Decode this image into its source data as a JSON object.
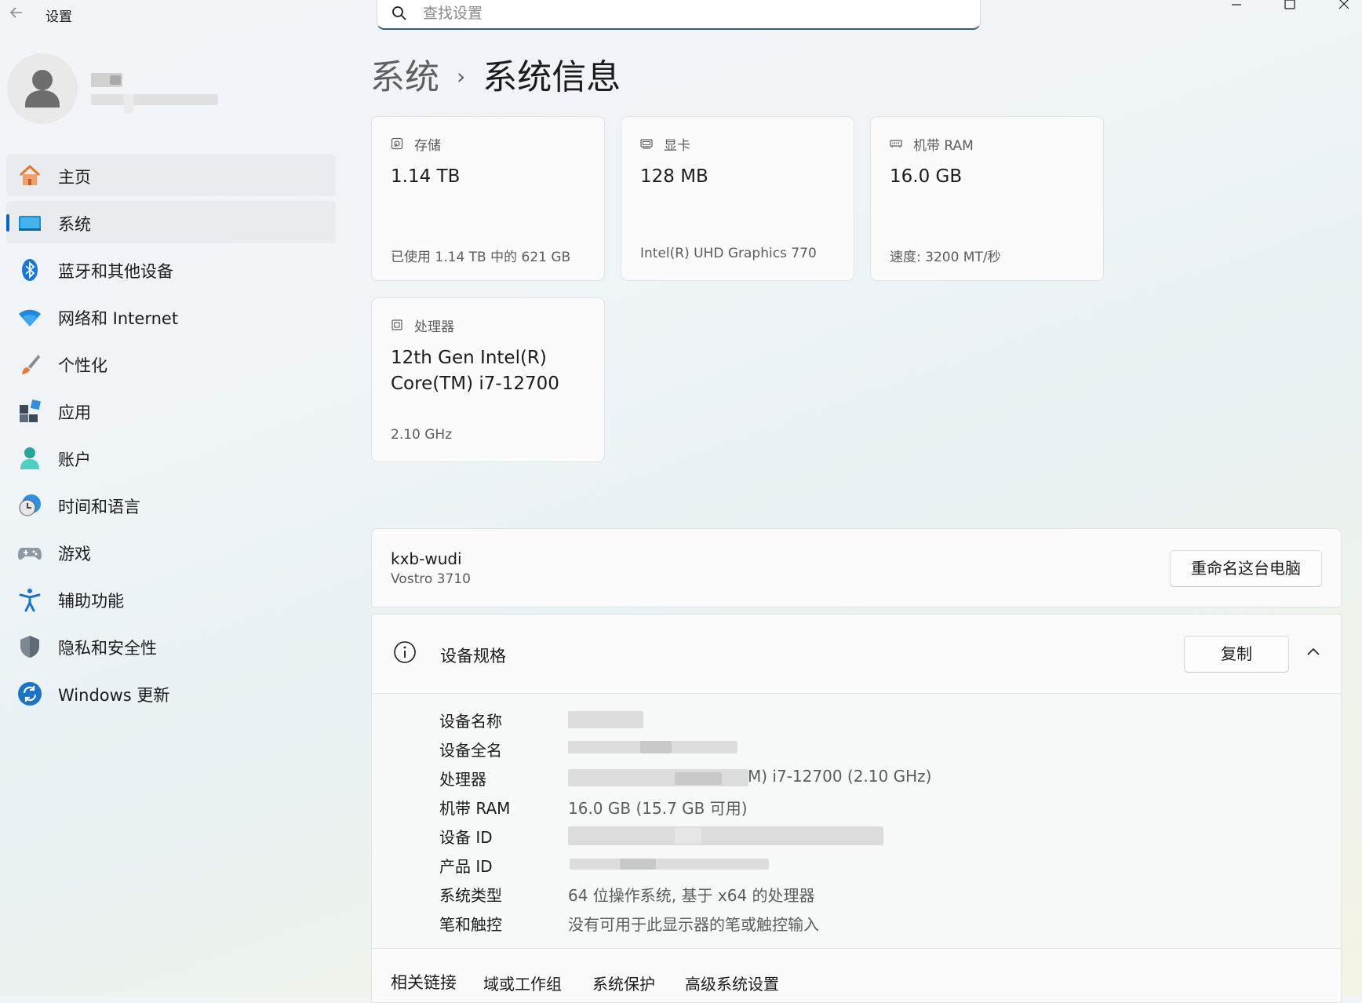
{
  "window": {
    "title": "设置",
    "back_icon": "arrow-left-icon",
    "controls": [
      "minimize-icon",
      "maximize-icon",
      "close-icon"
    ]
  },
  "search": {
    "placeholder": "查找设置",
    "value": ""
  },
  "sidebar": {
    "items": [
      {
        "label": "主页",
        "icon": "home-icon"
      },
      {
        "label": "系统",
        "icon": "system-icon"
      },
      {
        "label": "蓝牙和其他设备",
        "icon": "bluetooth-icon"
      },
      {
        "label": "网络和 Internet",
        "icon": "wifi-icon"
      },
      {
        "label": "个性化",
        "icon": "brush-icon"
      },
      {
        "label": "应用",
        "icon": "apps-icon"
      },
      {
        "label": "账户",
        "icon": "account-icon"
      },
      {
        "label": "时间和语言",
        "icon": "time-language-icon"
      },
      {
        "label": "游戏",
        "icon": "gamepad-icon"
      },
      {
        "label": "辅助功能",
        "icon": "accessibility-icon"
      },
      {
        "label": "隐私和安全性",
        "icon": "shield-icon"
      },
      {
        "label": "Windows 更新",
        "icon": "update-icon"
      }
    ]
  },
  "breadcrumb": {
    "parent": "系统",
    "separator": "›",
    "current": "系统信息"
  },
  "cards": {
    "storage": {
      "title": "存储",
      "value": "1.14 TB",
      "sub": "已使用 1.14 TB 中的 621 GB"
    },
    "gpu": {
      "title": "显卡",
      "value": "128 MB",
      "sub": "Intel(R) UHD Graphics 770"
    },
    "ram": {
      "title": "机带 RAM",
      "value": "16.0 GB",
      "sub": "速度: 3200 MT/秒"
    },
    "cpu": {
      "title": "处理器",
      "value": "12th Gen Intel(R) Core(TM) i7-12700",
      "sub": "2.10 GHz"
    }
  },
  "device": {
    "name": "kxb-wudi",
    "model": "Vostro 3710",
    "rename_label": "重命名这台电脑"
  },
  "specs": {
    "title": "设备规格",
    "copy_label": "复制",
    "rows": [
      {
        "label": "设备名称",
        "value": ""
      },
      {
        "label": "设备全名",
        "value": ""
      },
      {
        "label": "处理器",
        "value": "M) i7-12700 (2.10 GHz)"
      },
      {
        "label": "机带 RAM",
        "value": "16.0 GB (15.7 GB 可用)"
      },
      {
        "label": "设备 ID",
        "value": ""
      },
      {
        "label": "产品 ID",
        "value": ""
      },
      {
        "label": "系统类型",
        "value": "64 位操作系统, 基于 x64 的处理器"
      },
      {
        "label": "笔和触控",
        "value": "没有可用于此显示器的笔或触控输入"
      }
    ]
  },
  "related": {
    "title": "相关链接",
    "links": [
      "域或工作组",
      "系统保护",
      "高级系统设置"
    ]
  },
  "colors": {
    "accent": "#0067c0",
    "card_bg": "#fbfbfb",
    "nav_selected_bg": "#e9ecee"
  }
}
